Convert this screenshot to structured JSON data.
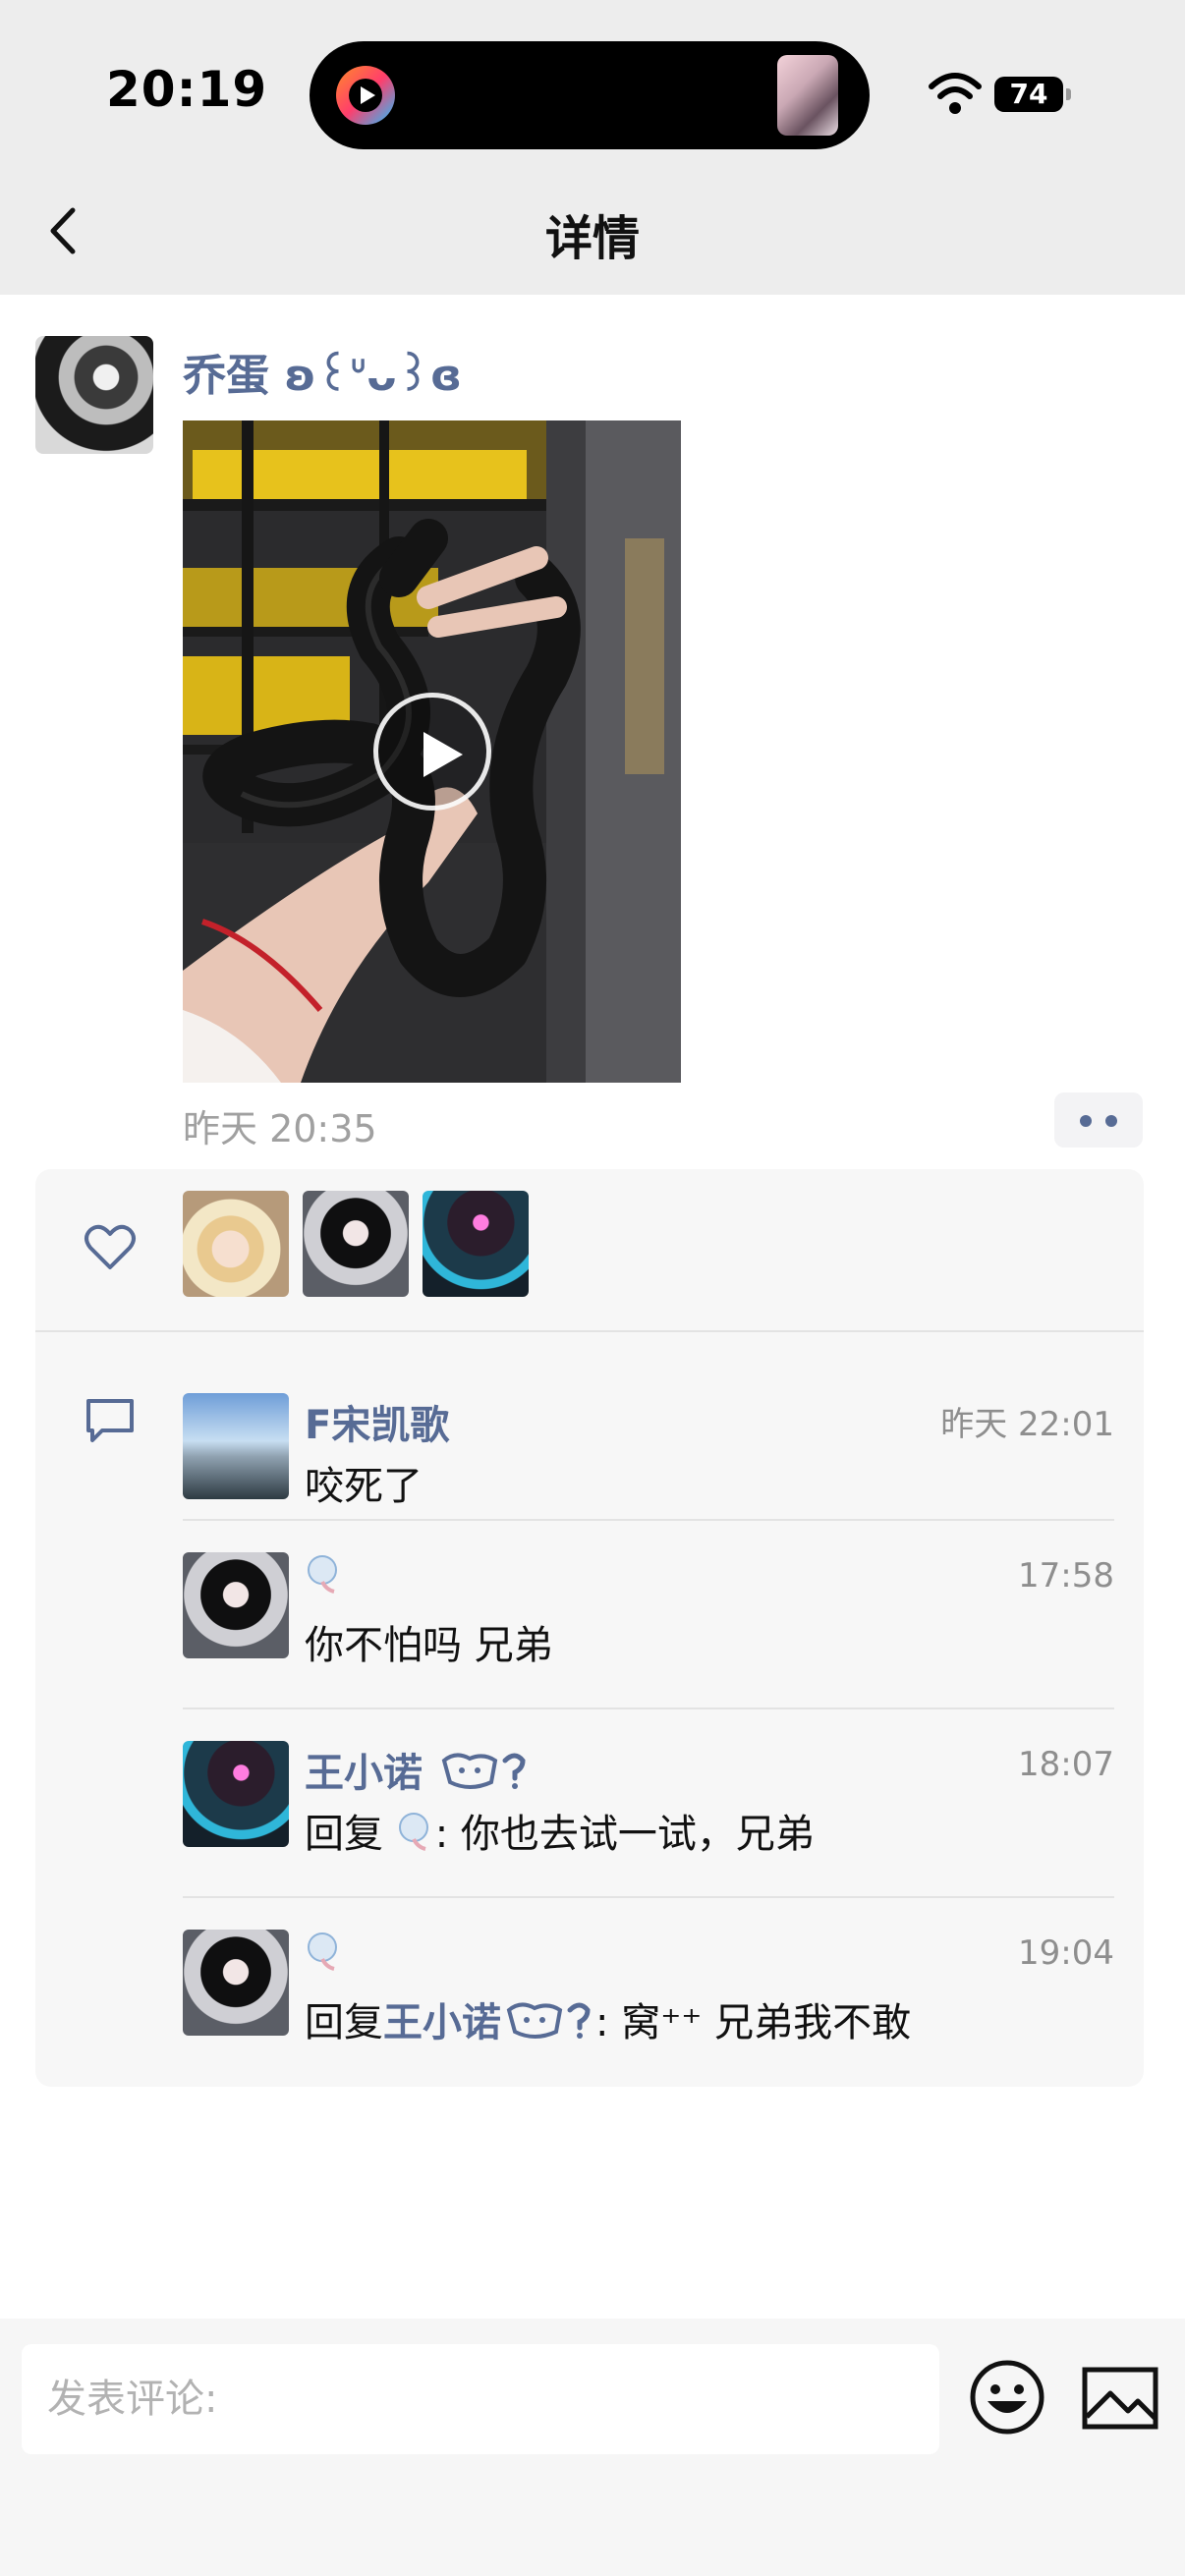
{
  "status_bar": {
    "time": "20:19",
    "battery": "74"
  },
  "header": {
    "title": "详情"
  },
  "post": {
    "author": "乔蛋 ʚ꒰ᐡᴗ꒱ɞ",
    "timestamp": "昨天 20:35"
  },
  "comments": [
    {
      "name": "F宋凯歌",
      "time": "昨天 22:01",
      "text": "咬死了"
    },
    {
      "name": "",
      "time": "17:58",
      "text": "你不怕吗 兄弟"
    },
    {
      "name": "王小诺",
      "time": "18:07",
      "reply_prefix": "回复",
      "reply_suffix": ": 你也去试一试，兄弟"
    },
    {
      "name": "",
      "time": "19:04",
      "reply_prefix": "回复",
      "reply_target": "王小诺",
      "reply_suffix": ": 窝⁺⁺ 兄弟我不敢"
    }
  ],
  "composer": {
    "placeholder": "发表评论:"
  },
  "colors": {
    "link_blue": "#576b95",
    "panel_bg": "#f7f7f7",
    "header_bg": "#ededed"
  }
}
